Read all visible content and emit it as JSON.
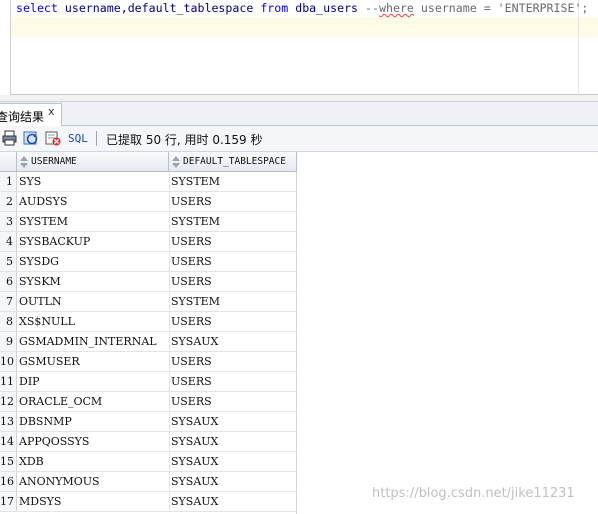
{
  "editor": {
    "sql_keyword_select": "select",
    "sql_columns": " username,default_tablespace ",
    "sql_keyword_from": "from",
    "sql_space": " ",
    "sql_table": "dba_users",
    "sql_comment_dashes": " --",
    "sql_comment_where": "where",
    "sql_comment_rest": " username = 'ENTERPRISE';"
  },
  "results_tab": {
    "label": "查询结果",
    "close": "x"
  },
  "toolbar": {
    "sql_label": "SQL",
    "status": "已提取 50 行, 用时 0.159 秒"
  },
  "grid": {
    "columns": [
      "USERNAME",
      "DEFAULT_TABLESPACE"
    ],
    "rows": [
      {
        "n": "1",
        "username": "SYS",
        "tablespace": "SYSTEM"
      },
      {
        "n": "2",
        "username": "AUDSYS",
        "tablespace": "USERS"
      },
      {
        "n": "3",
        "username": "SYSTEM",
        "tablespace": "SYSTEM"
      },
      {
        "n": "4",
        "username": "SYSBACKUP",
        "tablespace": "USERS"
      },
      {
        "n": "5",
        "username": "SYSDG",
        "tablespace": "USERS"
      },
      {
        "n": "6",
        "username": "SYSKM",
        "tablespace": "USERS"
      },
      {
        "n": "7",
        "username": "OUTLN",
        "tablespace": "SYSTEM"
      },
      {
        "n": "8",
        "username": "XS$NULL",
        "tablespace": "USERS"
      },
      {
        "n": "9",
        "username": "GSMADMIN_INTERNAL",
        "tablespace": "SYSAUX"
      },
      {
        "n": "10",
        "username": "GSMUSER",
        "tablespace": "USERS"
      },
      {
        "n": "11",
        "username": "DIP",
        "tablespace": "USERS"
      },
      {
        "n": "12",
        "username": "ORACLE_OCM",
        "tablespace": "USERS"
      },
      {
        "n": "13",
        "username": "DBSNMP",
        "tablespace": "SYSAUX"
      },
      {
        "n": "14",
        "username": "APPQOSSYS",
        "tablespace": "SYSAUX"
      },
      {
        "n": "15",
        "username": "XDB",
        "tablespace": "SYSAUX"
      },
      {
        "n": "16",
        "username": "ANONYMOUS",
        "tablespace": "SYSAUX"
      },
      {
        "n": "17",
        "username": "MDSYS",
        "tablespace": "SYSAUX"
      }
    ]
  },
  "watermark": "https://blog.csdn.net/jike11231",
  "colors": {
    "keyword": "#0000ff",
    "identifier": "#000080",
    "comment": "#6a6a6a",
    "current_line": "#fffbe6"
  },
  "icons": [
    "refresh-icon",
    "query-icon",
    "cancel-icon",
    "sort-icon"
  ]
}
